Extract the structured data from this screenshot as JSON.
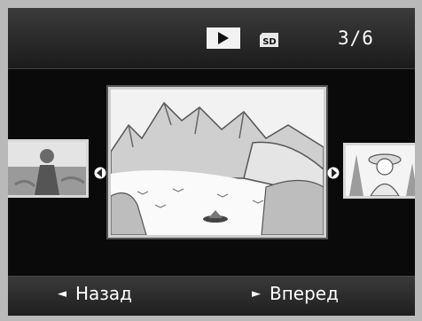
{
  "status": {
    "mode_icon": "play-icon",
    "media_icon": "sd-card-icon",
    "counter": "3/6"
  },
  "gallery": {
    "prev_thumbnail": "person-photo-thumbnail",
    "current_photo": "mountain-lake-photo",
    "next_thumbnail": "woman-hat-photo-thumbnail"
  },
  "nav": {
    "back_arrow": "◄",
    "back_label": "Назад",
    "forward_arrow": "►",
    "forward_label": "Вперед"
  },
  "colors": {
    "background": "#0a0a0a",
    "bar": "#2b2b2b",
    "text": "#ffffff",
    "frame": "#d0d0d0"
  }
}
